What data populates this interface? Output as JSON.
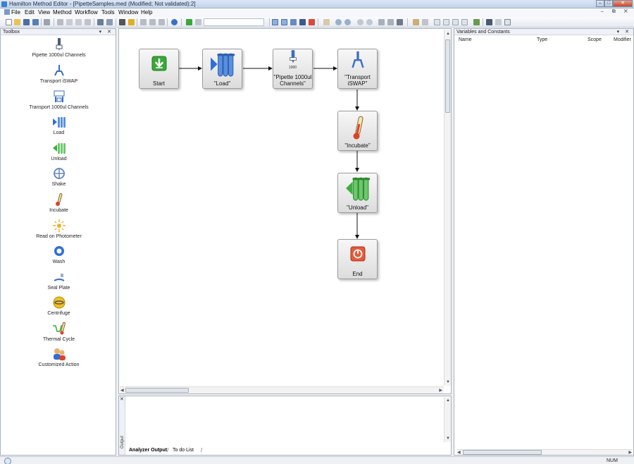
{
  "window": {
    "title": "Hamilton Method Editor - [PipetteSamples.med (Modified; Not validated):2]",
    "controls": [
      "–",
      "□",
      "✕"
    ]
  },
  "menu": {
    "items": [
      "File",
      "Edit",
      "View",
      "Method",
      "Workflow",
      "Tools",
      "Window",
      "Help"
    ],
    "mdi_controls": "– ⧉ ✕"
  },
  "toolbox": {
    "title": "Toolbox",
    "controls": "▾ ✕",
    "items": [
      {
        "label": "Pipette 1000ul Channels",
        "icon": "pipette-icon"
      },
      {
        "label": "Transport iSWAP",
        "icon": "gripper-icon"
      },
      {
        "label": "Transport 1000ul Channels",
        "icon": "channel-gripper-icon"
      },
      {
        "label": "Load",
        "icon": "load-icon"
      },
      {
        "label": "Unload",
        "icon": "unload-icon"
      },
      {
        "label": "Shake",
        "icon": "shake-icon"
      },
      {
        "label": "Incubate",
        "icon": "thermometer-icon"
      },
      {
        "label": "Read on Photometer",
        "icon": "photometer-icon"
      },
      {
        "label": "Wash",
        "icon": "wash-icon"
      },
      {
        "label": "Seal Plate",
        "icon": "seal-icon"
      },
      {
        "label": "Centrifuge",
        "icon": "centrifuge-icon"
      },
      {
        "label": "Thermal Cycle",
        "icon": "thermal-cycle-icon"
      },
      {
        "label": "Customized Action",
        "icon": "custom-action-icon"
      }
    ]
  },
  "workflow": {
    "nodes": [
      {
        "id": "start",
        "label": "Start",
        "icon": "start-icon"
      },
      {
        "id": "load",
        "label": "\"Load\"",
        "icon": "load-icon"
      },
      {
        "id": "pipette",
        "label": "\"Pipette 1000ul Channels\"",
        "icon": "pipette-icon"
      },
      {
        "id": "transport",
        "label": "\"Transport iSWAP\"",
        "icon": "gripper-icon"
      },
      {
        "id": "incubate",
        "label": "\"Incubate\"",
        "icon": "thermometer-icon"
      },
      {
        "id": "unload",
        "label": "\"Unload\"",
        "icon": "unload-icon"
      },
      {
        "id": "end",
        "label": "End",
        "icon": "end-icon"
      }
    ],
    "pipette_tip_label": "1000"
  },
  "output": {
    "side_label": "Output",
    "close": "✕",
    "tabs": [
      "Analyzer Output",
      "To do List"
    ]
  },
  "variables": {
    "title": "Variables and Constants",
    "controls": "▾ ✕",
    "columns": [
      "Name",
      "Type",
      "Scope",
      "Modifier"
    ]
  },
  "status": {
    "num": "NUM"
  },
  "colors": {
    "accent": "#3a7fd1",
    "start_green": "#3aa83a",
    "end_red": "#d9432b",
    "load_blue": "#2f6fd6",
    "unload_green": "#3fae3f"
  }
}
